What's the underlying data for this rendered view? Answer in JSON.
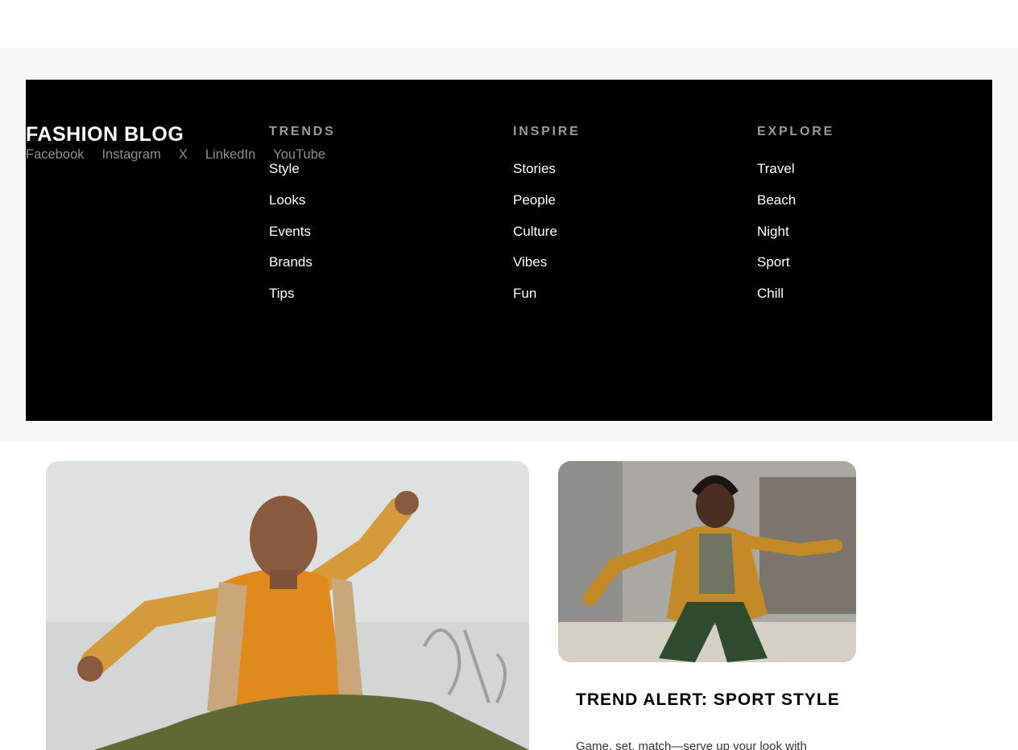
{
  "footer": {
    "brand": "FASHION BLOG",
    "social": [
      "Facebook",
      "Instagram",
      "X",
      "LinkedIn",
      "YouTube"
    ],
    "columns": [
      {
        "heading": "TRENDS",
        "items": [
          "Style",
          "Looks",
          "Events",
          "Brands",
          "Tips"
        ]
      },
      {
        "heading": "INSPIRE",
        "items": [
          "Stories",
          "People",
          "Culture",
          "Vibes",
          "Fun"
        ]
      },
      {
        "heading": "EXPLORE",
        "items": [
          "Travel",
          "Beach",
          "Night",
          "Sport",
          "Chill"
        ]
      }
    ]
  },
  "cards": {
    "featured": {
      "title": "TREND ALERT: SPORT STYLE",
      "excerpt": "Game, set, match—serve up your look with"
    }
  },
  "colors": {
    "footer_bg": "#000000",
    "band_bg": "#f6f6f6",
    "heading_gray": "#9b9b9b",
    "social_gray": "#8e8e8e"
  },
  "icons": []
}
